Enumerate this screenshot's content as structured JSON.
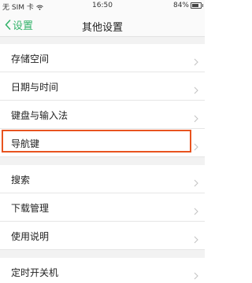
{
  "status_bar": {
    "carrier": "无 SIM 卡",
    "time": "16:50",
    "battery": "84%"
  },
  "nav": {
    "back_label": "设置",
    "title": "其他设置"
  },
  "groups": [
    {
      "items": [
        "存储空间",
        "日期与时间",
        "键盘与输入法",
        "导航键"
      ]
    },
    {
      "items": [
        "搜索",
        "下载管理",
        "使用说明"
      ]
    },
    {
      "items": [
        "定时开关机"
      ]
    }
  ],
  "highlighted_item": "导航键",
  "colors": {
    "accent": "#33b36a",
    "highlight": "#e8531f",
    "background": "#f2f2f2"
  }
}
